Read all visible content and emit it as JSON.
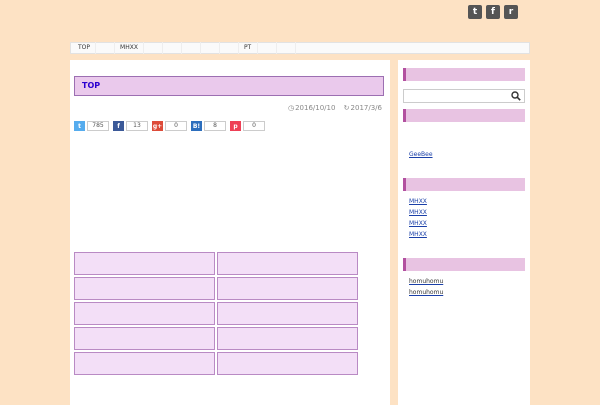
{
  "site": {
    "title": "",
    "description": ""
  },
  "social": [
    {
      "icon": "twitter-icon",
      "glyph": "t"
    },
    {
      "icon": "feedly-icon",
      "glyph": "f"
    },
    {
      "icon": "rss-icon",
      "glyph": "r"
    }
  ],
  "nav": [
    {
      "label": "TOP"
    },
    {
      "label": ""
    },
    {
      "label": "MHXX"
    },
    {
      "label": ""
    },
    {
      "label": ""
    },
    {
      "label": ""
    },
    {
      "label": ""
    },
    {
      "label": ""
    },
    {
      "label": "PT"
    },
    {
      "label": ""
    },
    {
      "label": ""
    }
  ],
  "post": {
    "title": "",
    "title_suffix": "TOP",
    "published": "2016/10/10",
    "updated": "2017/3/6",
    "share": [
      {
        "icon": "twitter-icon",
        "glyph": "t",
        "color": "#55acee",
        "count": "785"
      },
      {
        "icon": "facebook-icon",
        "glyph": "f",
        "color": "#3b5998",
        "count": "13"
      },
      {
        "icon": "google-plus-icon",
        "glyph": "g+",
        "color": "#dd4b39",
        "count": "0"
      },
      {
        "icon": "hatena-icon",
        "glyph": "B!",
        "color": "#2c6ebd",
        "count": "8"
      },
      {
        "icon": "pocket-icon",
        "glyph": "p",
        "color": "#ee4056",
        "count": "0"
      }
    ],
    "paragraphs": [
      {
        "text": "",
        "style": "red"
      },
      {
        "text": "",
        "style": ""
      },
      {
        "text": "",
        "style": ""
      },
      {
        "text": "",
        "style": "red"
      },
      {
        "text": "",
        "style": "red"
      },
      {
        "text": "",
        "style": ""
      },
      {
        "text": "",
        "style": ""
      }
    ],
    "grid": [
      {
        "line1": "",
        "line2": ""
      },
      {
        "line1": "",
        "line2": ""
      },
      {
        "line1": "",
        "line2": ""
      },
      {
        "line1": "",
        "line2": ""
      },
      {
        "line1": "",
        "line2": ""
      },
      {
        "line1": "",
        "line2": ""
      },
      {
        "line1": "",
        "line2": ""
      },
      {
        "line1": "",
        "line2": ""
      },
      {
        "line1": "",
        "line2": ""
      },
      {
        "line1": "",
        "line2": ""
      }
    ]
  },
  "sidebar": {
    "search": {
      "title": "",
      "placeholder": ""
    },
    "widget2": {
      "title": "",
      "items": [
        {
          "text": ""
        },
        {
          "text": ""
        },
        {
          "text": "GeeBee"
        },
        {
          "text": ""
        }
      ]
    },
    "widget3": {
      "title": "",
      "items": [
        {
          "text": "MHXX"
        },
        {
          "text": "MHXX"
        },
        {
          "text": "MHXX"
        },
        {
          "text": "MHXX"
        },
        {
          "text": ""
        }
      ]
    },
    "widget4": {
      "title": "",
      "items": [
        {
          "text": "",
          "by": "homuhomu"
        },
        {
          "text": "",
          "by": "homuhomu"
        },
        {
          "text": "",
          "by": ""
        }
      ]
    }
  },
  "colors": {
    "background": "#fde2c4",
    "accent_purple": "#b2509f",
    "title_blue": "#2b00d0",
    "link_blue": "#1a3fa8",
    "red_text": "#cc0000"
  }
}
